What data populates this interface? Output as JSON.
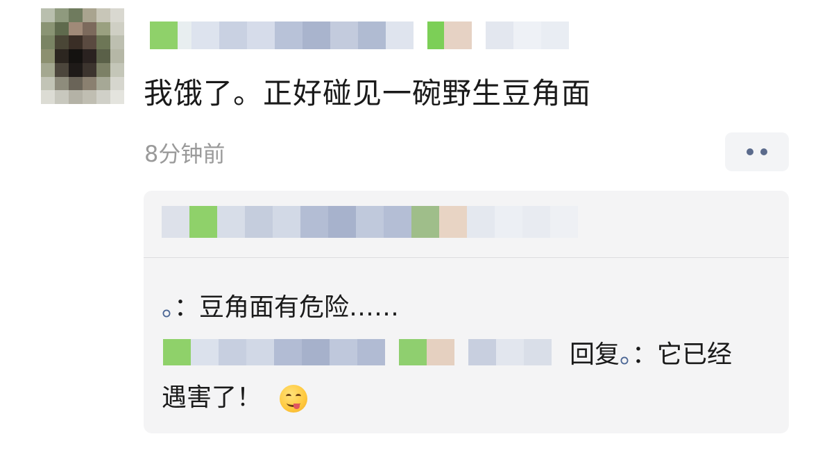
{
  "post": {
    "text": "我饿了。正好碰见一碗野生豆角面",
    "timestamp": "8分钟前"
  },
  "comments": [
    {
      "author": "。",
      "separator": "：",
      "text": "豆角面有危险……"
    },
    {
      "reply_word": "回复",
      "reply_to": "。",
      "separator": "：",
      "text_line1": "它已经",
      "text_line2": "遇害了！",
      "emoji": "yum-face-icon"
    }
  ],
  "icons": {
    "more": "more-dots-icon",
    "emoji": "yum-face-icon"
  },
  "colors": {
    "link": "#4a6594",
    "timestamp": "#9a9a9a",
    "panel_bg": "#f4f4f5"
  }
}
